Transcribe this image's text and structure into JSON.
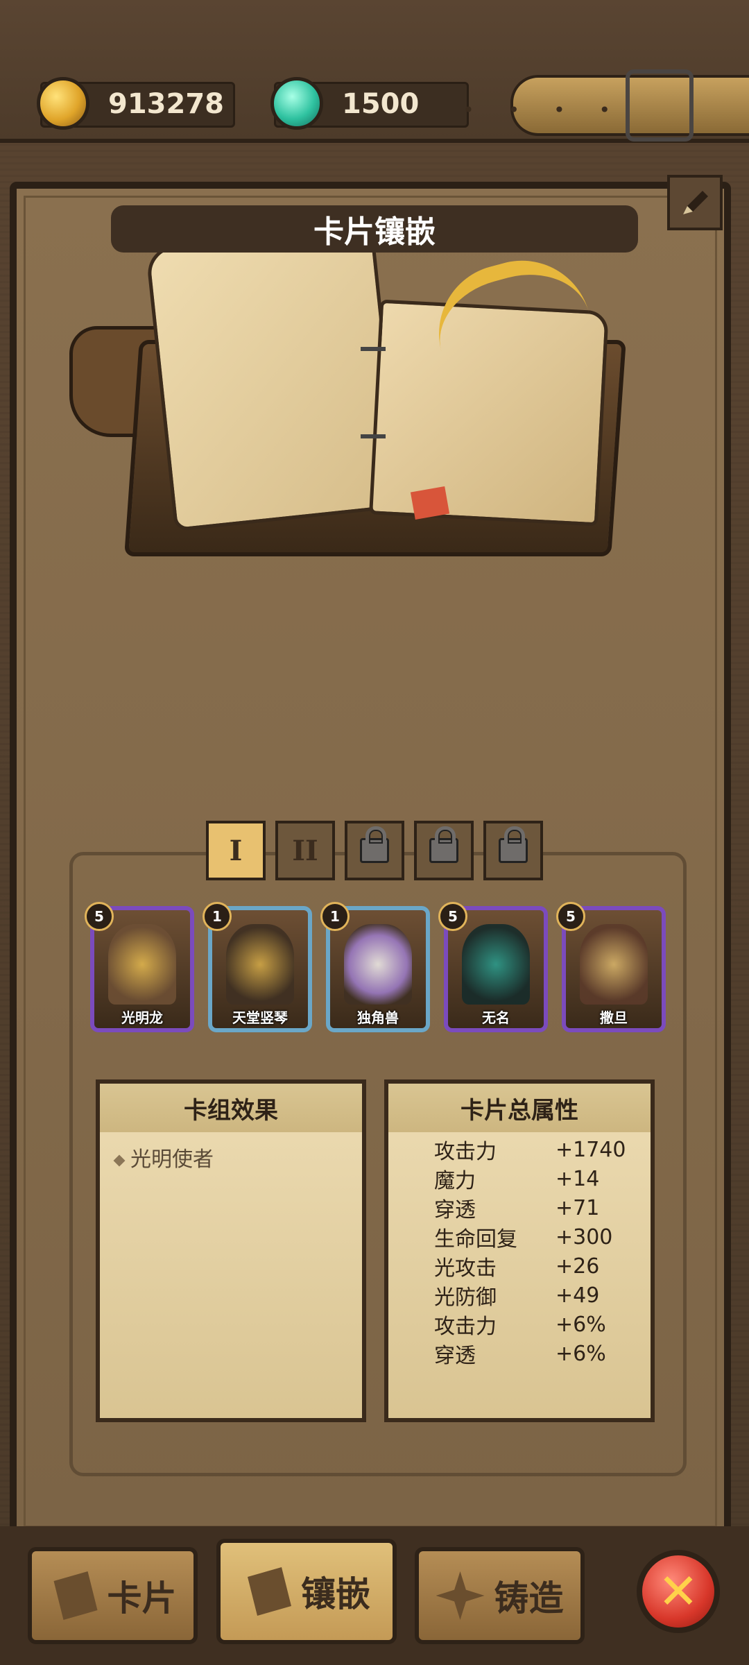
{
  "resources": {
    "gold": "913278",
    "gems": "1500"
  },
  "title": "卡片镶嵌",
  "tabs": [
    {
      "label": "I",
      "active": true,
      "locked": false
    },
    {
      "label": "II",
      "active": false,
      "locked": false
    },
    {
      "label": "",
      "active": false,
      "locked": true
    },
    {
      "label": "",
      "active": false,
      "locked": true
    },
    {
      "label": "",
      "active": false,
      "locked": true
    }
  ],
  "cards": [
    {
      "level": "5",
      "name": "光明龙",
      "frame": "purple"
    },
    {
      "level": "1",
      "name": "天堂竖琴",
      "frame": "blue"
    },
    {
      "level": "1",
      "name": "独角兽",
      "frame": "blue"
    },
    {
      "level": "5",
      "name": "无名",
      "frame": "purple"
    },
    {
      "level": "5",
      "name": "撒旦",
      "frame": "purple"
    }
  ],
  "deck_effects": {
    "title": "卡组效果",
    "items": [
      "光明使者"
    ]
  },
  "card_stats": {
    "title": "卡片总属性",
    "rows": [
      {
        "k": "攻击力",
        "v": "+1740"
      },
      {
        "k": "魔力",
        "v": "+14"
      },
      {
        "k": "穿透",
        "v": "+71"
      },
      {
        "k": "生命回复",
        "v": "+300"
      },
      {
        "k": "光攻击",
        "v": "+26"
      },
      {
        "k": "光防御",
        "v": "+49"
      },
      {
        "k": "攻击力",
        "v": "+6%"
      },
      {
        "k": "穿透",
        "v": "+6%"
      }
    ]
  },
  "bottom_nav": {
    "cards": "卡片",
    "inlay": "镶嵌",
    "forge": "铸造"
  }
}
